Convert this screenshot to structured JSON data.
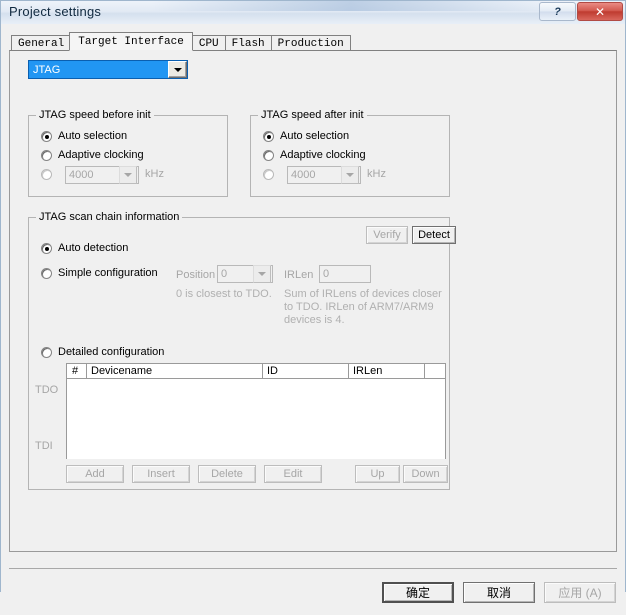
{
  "window": {
    "title": "Project settings",
    "help_button": "?",
    "close_button": "✕"
  },
  "tabs": [
    {
      "label": "General",
      "active": false
    },
    {
      "label": "Target Interface",
      "active": true
    },
    {
      "label": "CPU",
      "active": false
    },
    {
      "label": "Flash",
      "active": false
    },
    {
      "label": "Production",
      "active": false
    }
  ],
  "interface_combo": {
    "value": "JTAG",
    "selected_color": "#2196f3"
  },
  "speed_before": {
    "legend": "JTAG speed before init",
    "options": [
      {
        "label": "Auto selection",
        "selected": true,
        "disabled": false
      },
      {
        "label": "Adaptive clocking",
        "selected": false,
        "disabled": false
      },
      {
        "label": "",
        "selected": false,
        "disabled": true
      }
    ],
    "value": "4000",
    "unit": "kHz"
  },
  "speed_after": {
    "legend": "JTAG speed after init",
    "options": [
      {
        "label": "Auto selection",
        "selected": true,
        "disabled": false
      },
      {
        "label": "Adaptive clocking",
        "selected": false,
        "disabled": false
      },
      {
        "label": "",
        "selected": false,
        "disabled": true
      }
    ],
    "value": "4000",
    "unit": "kHz"
  },
  "scan_chain": {
    "legend": "JTAG scan chain information",
    "verify_button": "Verify",
    "detect_button": "Detect",
    "auto_detection": "Auto detection",
    "simple_configuration": "Simple configuration",
    "detailed_configuration": "Detailed configuration",
    "position_label": "Position",
    "position_value": "0",
    "position_hint": "0 is closest to TDO.",
    "irlen_label": "IRLen",
    "irlen_value": "0",
    "irlen_hint": "Sum of IRLens of devices closer to TDO. IRLen of ARM7/ARM9 devices is 4.",
    "tdo_label": "TDO",
    "tdi_label": "TDI",
    "table": {
      "columns": [
        "#",
        "Devicename",
        "ID",
        "IRLen",
        ""
      ],
      "rows": []
    },
    "table_buttons": [
      {
        "label": "Add",
        "disabled": true
      },
      {
        "label": "Insert",
        "disabled": true
      },
      {
        "label": "Delete",
        "disabled": true
      },
      {
        "label": "Edit",
        "disabled": true
      },
      {
        "label": "Up",
        "disabled": true
      },
      {
        "label": "Down",
        "disabled": true
      }
    ]
  },
  "footer": {
    "ok": "确定",
    "cancel": "取消",
    "apply": "应用 (A)"
  }
}
